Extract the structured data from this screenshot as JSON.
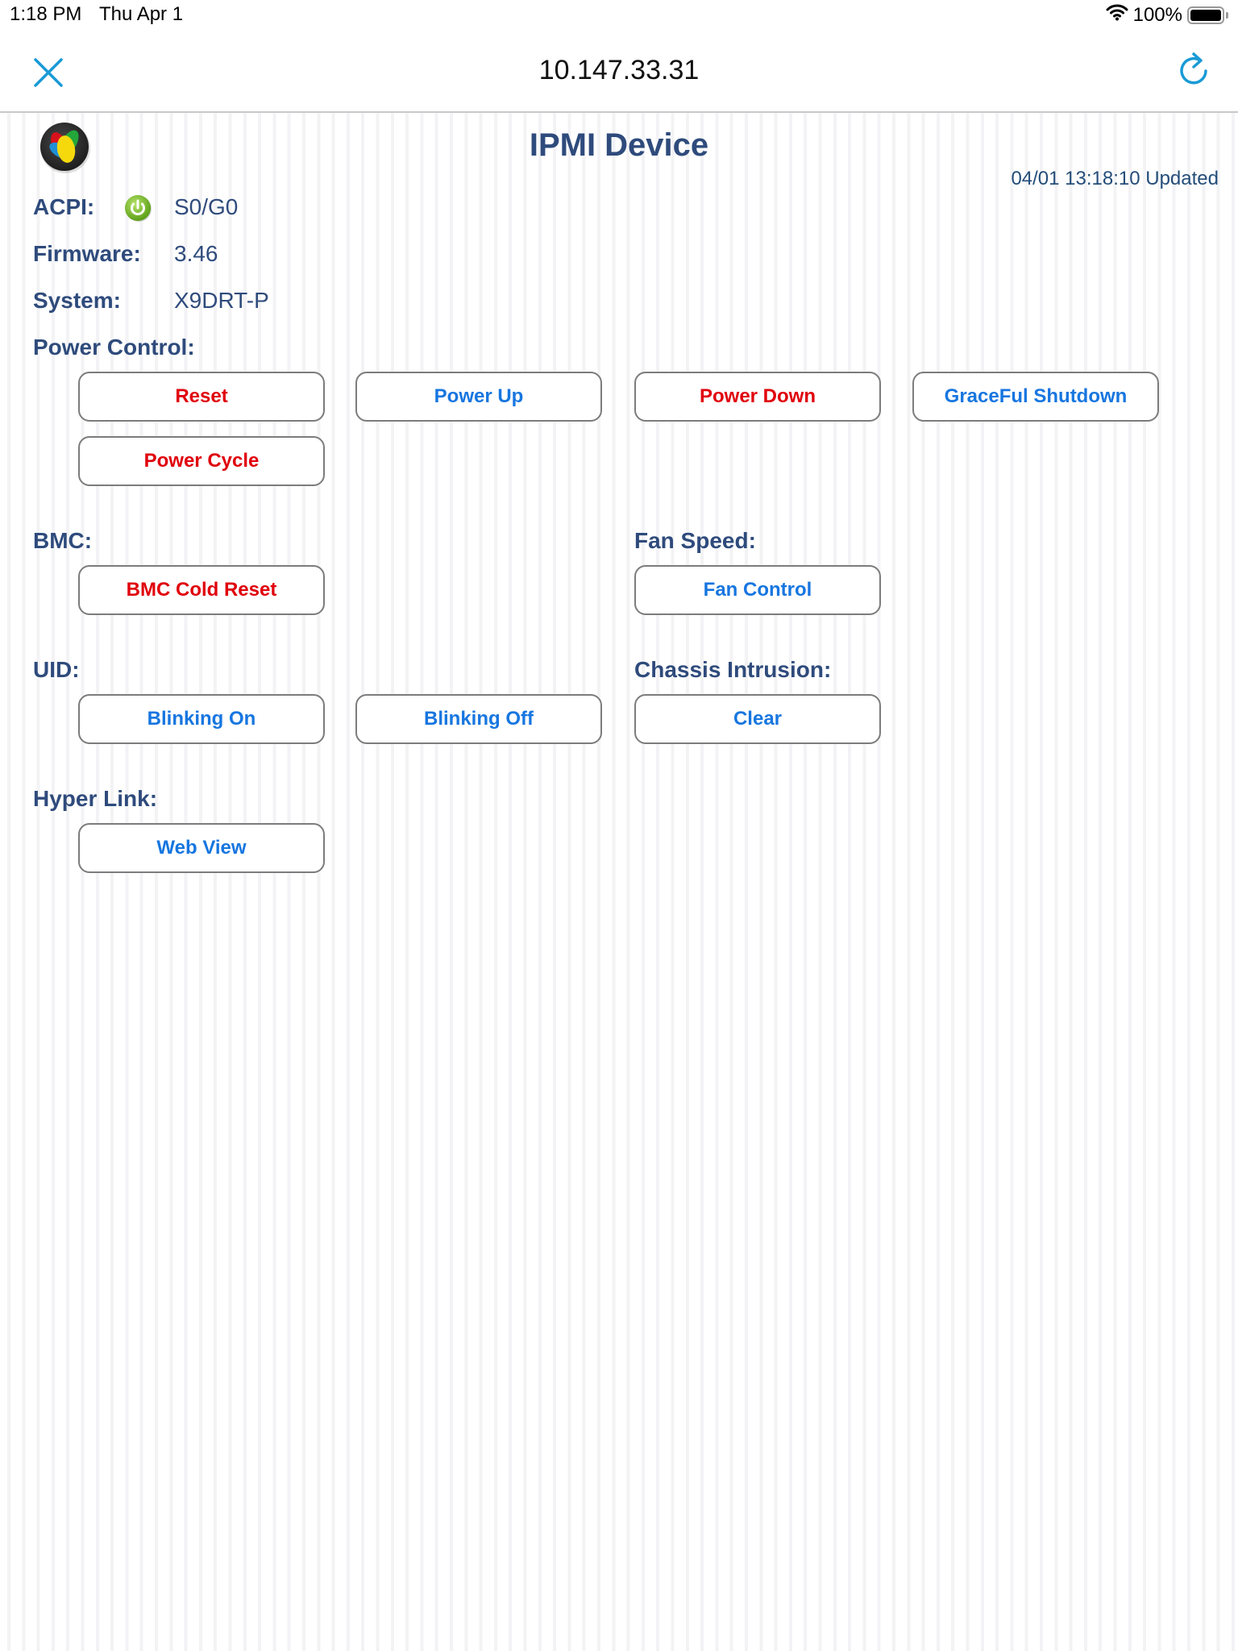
{
  "status_bar": {
    "time": "1:18 PM",
    "date": "Thu Apr 1",
    "wifi_icon": "wifi-icon",
    "battery_percent": "100%",
    "battery_level": 1.0
  },
  "nav": {
    "title": "10.147.33.31",
    "close_icon": "close-icon",
    "refresh_icon": "refresh-icon",
    "accent_color": "#1a9ad6"
  },
  "page": {
    "title": "IPMI Device",
    "updated": "04/01 13:18:10 Updated",
    "logo_icon": "app-logo-icon"
  },
  "info": {
    "acpi": {
      "label": "ACPI:",
      "value": "S0/G0",
      "icon": "power-on-icon",
      "icon_color": "#7cbd2a"
    },
    "firmware": {
      "label": "Firmware:",
      "value": "3.46"
    },
    "system": {
      "label": "System:",
      "value": "X9DRT-P"
    }
  },
  "sections": {
    "power_control": {
      "label": "Power Control:",
      "buttons": [
        {
          "label": "Reset",
          "color": "red"
        },
        {
          "label": "Power Up",
          "color": "blue"
        },
        {
          "label": "Power Down",
          "color": "red"
        },
        {
          "label": "GraceFul Shutdown",
          "color": "blue"
        },
        {
          "label": "Power Cycle",
          "color": "red"
        }
      ]
    },
    "bmc": {
      "label": "BMC:",
      "buttons": [
        {
          "label": "BMC Cold Reset",
          "color": "red"
        }
      ]
    },
    "fan_speed": {
      "label": "Fan Speed:",
      "buttons": [
        {
          "label": "Fan Control",
          "color": "blue"
        }
      ]
    },
    "uid": {
      "label": "UID:",
      "buttons": [
        {
          "label": "Blinking On",
          "color": "blue"
        },
        {
          "label": "Blinking Off",
          "color": "blue"
        }
      ]
    },
    "chassis_intrusion": {
      "label": "Chassis Intrusion:",
      "buttons": [
        {
          "label": "Clear",
          "color": "blue"
        }
      ]
    },
    "hyper_link": {
      "label": "Hyper Link:",
      "buttons": [
        {
          "label": "Web View",
          "color": "blue"
        }
      ]
    }
  },
  "colors": {
    "label_text": "#2f4b7c",
    "danger_button_text": "#e0000b",
    "action_button_text": "#1776e0",
    "button_border": "#7c7c7c"
  }
}
